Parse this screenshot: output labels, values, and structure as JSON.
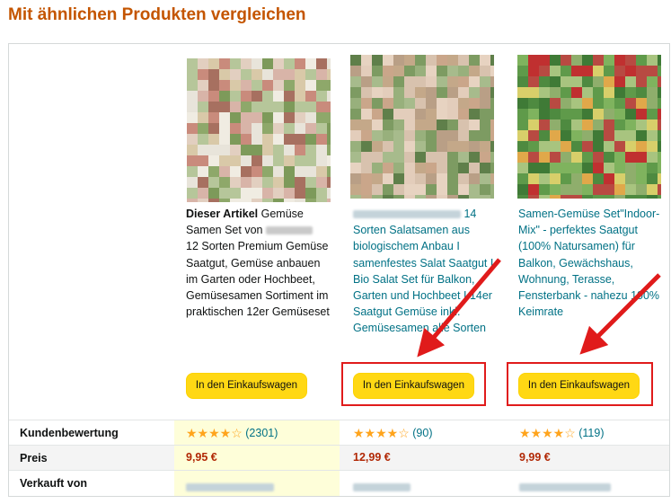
{
  "section_title": "Mit ähnlichen Produkten vergleichen",
  "products": [
    {
      "prefix": "Dieser Artikel",
      "lines": [
        "Samen Set von ",
        "12 Sorten Premium Gemüse",
        "Saatgut, Gemüse anbauen",
        "im Garten oder Hochbeet,",
        "Gemüsesamen Sortiment im",
        "praktischen 12er Gemüseset"
      ],
      "first_line_rest": " Gemüse",
      "cart_label": "In den Einkaufswagen",
      "rating_count": "(2301)",
      "price": "9,95 €"
    },
    {
      "lines": [
        "",
        "Sorten Salatsamen aus",
        "biologischem Anbau I",
        "samenfestes Salat Saatgut I",
        "Bio Salat Set für Balkon,",
        "Garten und Hochbeet I 14er",
        "Saatgut Gemüse inkl.",
        "Gemüsesamen alle Sorten"
      ],
      "first_line_tail": "14",
      "cart_label": "In den Einkaufswagen",
      "rating_count": "(90)",
      "price": "12,99 €"
    },
    {
      "lines": [
        "Samen-Gemüse Set\"Indoor-",
        "Mix\" - perfektes Saatgut",
        "(100% Natursamen) für",
        "Balkon, Gewächshaus,",
        "Wohnung, Terasse,",
        "Fensterbank - nahezu 100%",
        "Keimrate"
      ],
      "cart_label": "In den Einkaufswagen",
      "rating_count": "(119)",
      "price": "9,99 €"
    }
  ],
  "rows": {
    "rating_label": "Kundenbewertung",
    "price_label": "Preis",
    "seller_label": "Verkauft von"
  },
  "stars_glyph": "★★★★☆",
  "colors": {
    "title": "#c45500",
    "button": "#ffd814",
    "price": "#b12704",
    "link": "#007185",
    "arrow": "#e01b1b"
  }
}
